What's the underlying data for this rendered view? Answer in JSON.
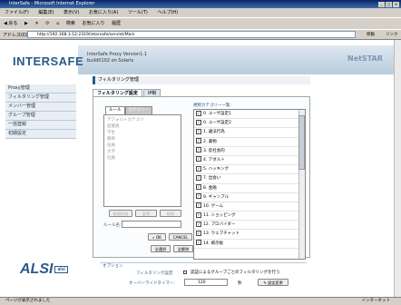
{
  "window": {
    "title": "InterSafe - Microsoft Internet Explorer"
  },
  "menu": [
    "ファイル(F)",
    "編集(E)",
    "表示(V)",
    "お気に入り(A)",
    "ツール(T)",
    "ヘルプ(H)"
  ],
  "toolbar": [
    "◀ 戻る",
    "▶",
    "✕",
    "⟳",
    "⌂",
    "検索",
    "お気に入り",
    "履歴"
  ],
  "address": {
    "label": "アドレス(D)",
    "url": "http://192.168.3.12:2319/intersafe/servlet/Main",
    "go": "移動",
    "links": "リンク"
  },
  "header": {
    "logo": "INTERSAFE",
    "product_line1": "InterSafe Proxy Version1.1",
    "product_line2": "build0102 on Solaris",
    "partner": "NetSTAR"
  },
  "sidebar": [
    "Proxy管理",
    "フィルタリング管理",
    "メンバー管理",
    "グループ管理",
    "一括登録",
    "初期設定"
  ],
  "vendor": {
    "name": "ALSI",
    "badge": "alsi"
  },
  "page": {
    "heading": "フィルタリング管理",
    "tabs": [
      "フィルタリング設定",
      "IP制"
    ],
    "subtabs": [
      "ルール",
      "カテゴリー"
    ],
    "rules": [
      "デフォルトカテゴリ",
      "従業員",
      "学生",
      "教師",
      "役員",
      "大学",
      "社員"
    ],
    "rule_buttons": [
      "新規作成",
      "変更",
      "削除"
    ],
    "rule_name_label": "ルール名:",
    "ok_label": "OK",
    "cancel_label": "CANCEL",
    "select_all": "全選択",
    "deselect_all": "全解除",
    "category_label": "規制カテゴリー一覧:",
    "categories": [
      "0. ユーザ設定1",
      "0. ユーザ設定2",
      "1. 違法行為",
      "2. 薬物",
      "3. 反社会的",
      "4. アダルト",
      "5. ハッキング",
      "7. 出会い",
      "8. 金融",
      "9. ギャンブル",
      "10. ゲーム",
      "11. ショッピング",
      "12. プロバイダー",
      "13. ウェブチャット",
      "14. 掲示板"
    ],
    "options_title": "オプション",
    "filtering_label": "フィルタリング設定:",
    "filtering_option": "認証によるグループごとのフィルタリングを行う",
    "timer_label": "オーバーライドタイマー:",
    "timer_value": "120",
    "timer_unit": "秒",
    "save_label": "設定変更"
  },
  "status": {
    "left": "ページが表示されました",
    "zone": "インターネット"
  }
}
